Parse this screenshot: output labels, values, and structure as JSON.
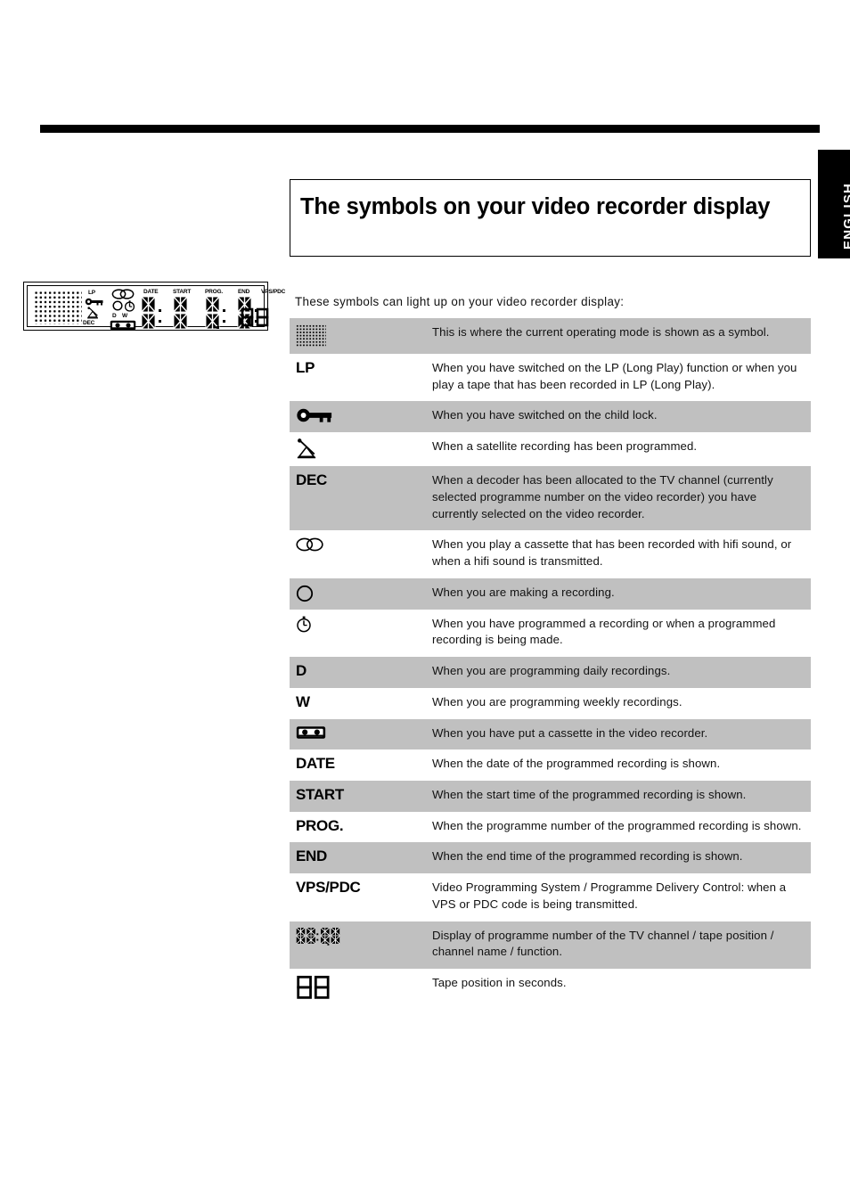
{
  "page": {
    "language_tab": "ENGLISH",
    "title": "The symbols on your video recorder display",
    "intro": "These symbols can light up on your video recorder display:"
  },
  "display_figure": {
    "name": "vcr-front-panel-display",
    "dot_matrix": "dot-matrix-block",
    "labels": [
      "LP",
      "DEC",
      "D",
      "W",
      "DATE",
      "START",
      "PROG.",
      "END",
      "VPS/PDC"
    ],
    "icons": [
      "dot-matrix",
      "key",
      "satellite-dish",
      "hifi",
      "record-circle",
      "clock",
      "cassette"
    ],
    "segment_groups": [
      "DATE",
      "START",
      "PROG.",
      "END",
      "VPS/PDC"
    ],
    "seconds_digits": "88"
  },
  "table": {
    "rows": [
      {
        "icon": "dot-matrix",
        "symbol": "",
        "shaded": true,
        "desc": "This is where the current operating mode is shown as a symbol."
      },
      {
        "icon": "text",
        "symbol": "LP",
        "shaded": false,
        "desc": "When you have switched on the LP (Long Play) function or when you play a tape that has been recorded in LP (Long Play)."
      },
      {
        "icon": "key",
        "symbol": "",
        "shaded": true,
        "desc": "When you have switched on the child lock."
      },
      {
        "icon": "satellite-dish",
        "symbol": "",
        "shaded": false,
        "desc": "When a satellite recording has been programmed."
      },
      {
        "icon": "text",
        "symbol": "DEC",
        "shaded": true,
        "desc": "When a decoder has been allocated to the TV channel (currently selected programme number on the video recorder) you have currently selected on the video recorder."
      },
      {
        "icon": "hifi",
        "symbol": "",
        "shaded": false,
        "desc": "When you play a cassette that has been recorded with hifi sound, or when a hifi sound is transmitted."
      },
      {
        "icon": "record-circle",
        "symbol": "",
        "shaded": true,
        "desc": "When you are making a recording."
      },
      {
        "icon": "clock",
        "symbol": "",
        "shaded": false,
        "desc": "When you have programmed a recording or when a programmed recording is being made."
      },
      {
        "icon": "text",
        "symbol": "D",
        "shaded": true,
        "desc": "When you are programming daily recordings."
      },
      {
        "icon": "text",
        "symbol": "W",
        "shaded": false,
        "desc": "When you are programming weekly recordings."
      },
      {
        "icon": "cassette",
        "symbol": "",
        "shaded": true,
        "desc": "When you have put a cassette in the video recorder."
      },
      {
        "icon": "text",
        "symbol": "DATE",
        "shaded": false,
        "desc": "When the date of the programmed recording is shown."
      },
      {
        "icon": "text",
        "symbol": "START",
        "shaded": true,
        "desc": "When the start time of the programmed recording is shown."
      },
      {
        "icon": "text",
        "symbol": "PROG.",
        "shaded": false,
        "desc": "When the programme number of the programmed recording is shown."
      },
      {
        "icon": "text",
        "symbol": "END",
        "shaded": true,
        "desc": "When the end time of the programmed recording is shown."
      },
      {
        "icon": "text",
        "symbol": "VPS/PDC",
        "shaded": false,
        "desc": "Video Programming System / Programme Delivery Control: when a VPS or PDC code is being transmitted."
      },
      {
        "icon": "four-segment-display",
        "symbol": "",
        "shaded": true,
        "desc": "Display of programme number of the TV channel / tape position / channel name / function."
      },
      {
        "icon": "two-segment-display",
        "symbol": "",
        "shaded": false,
        "desc": "Tape position in seconds."
      }
    ]
  },
  "colors": {
    "shade_row": "#c0c0c0",
    "text": "#111111",
    "rule": "#000000",
    "tab_bg": "#000000",
    "tab_text": "#ffffff"
  }
}
